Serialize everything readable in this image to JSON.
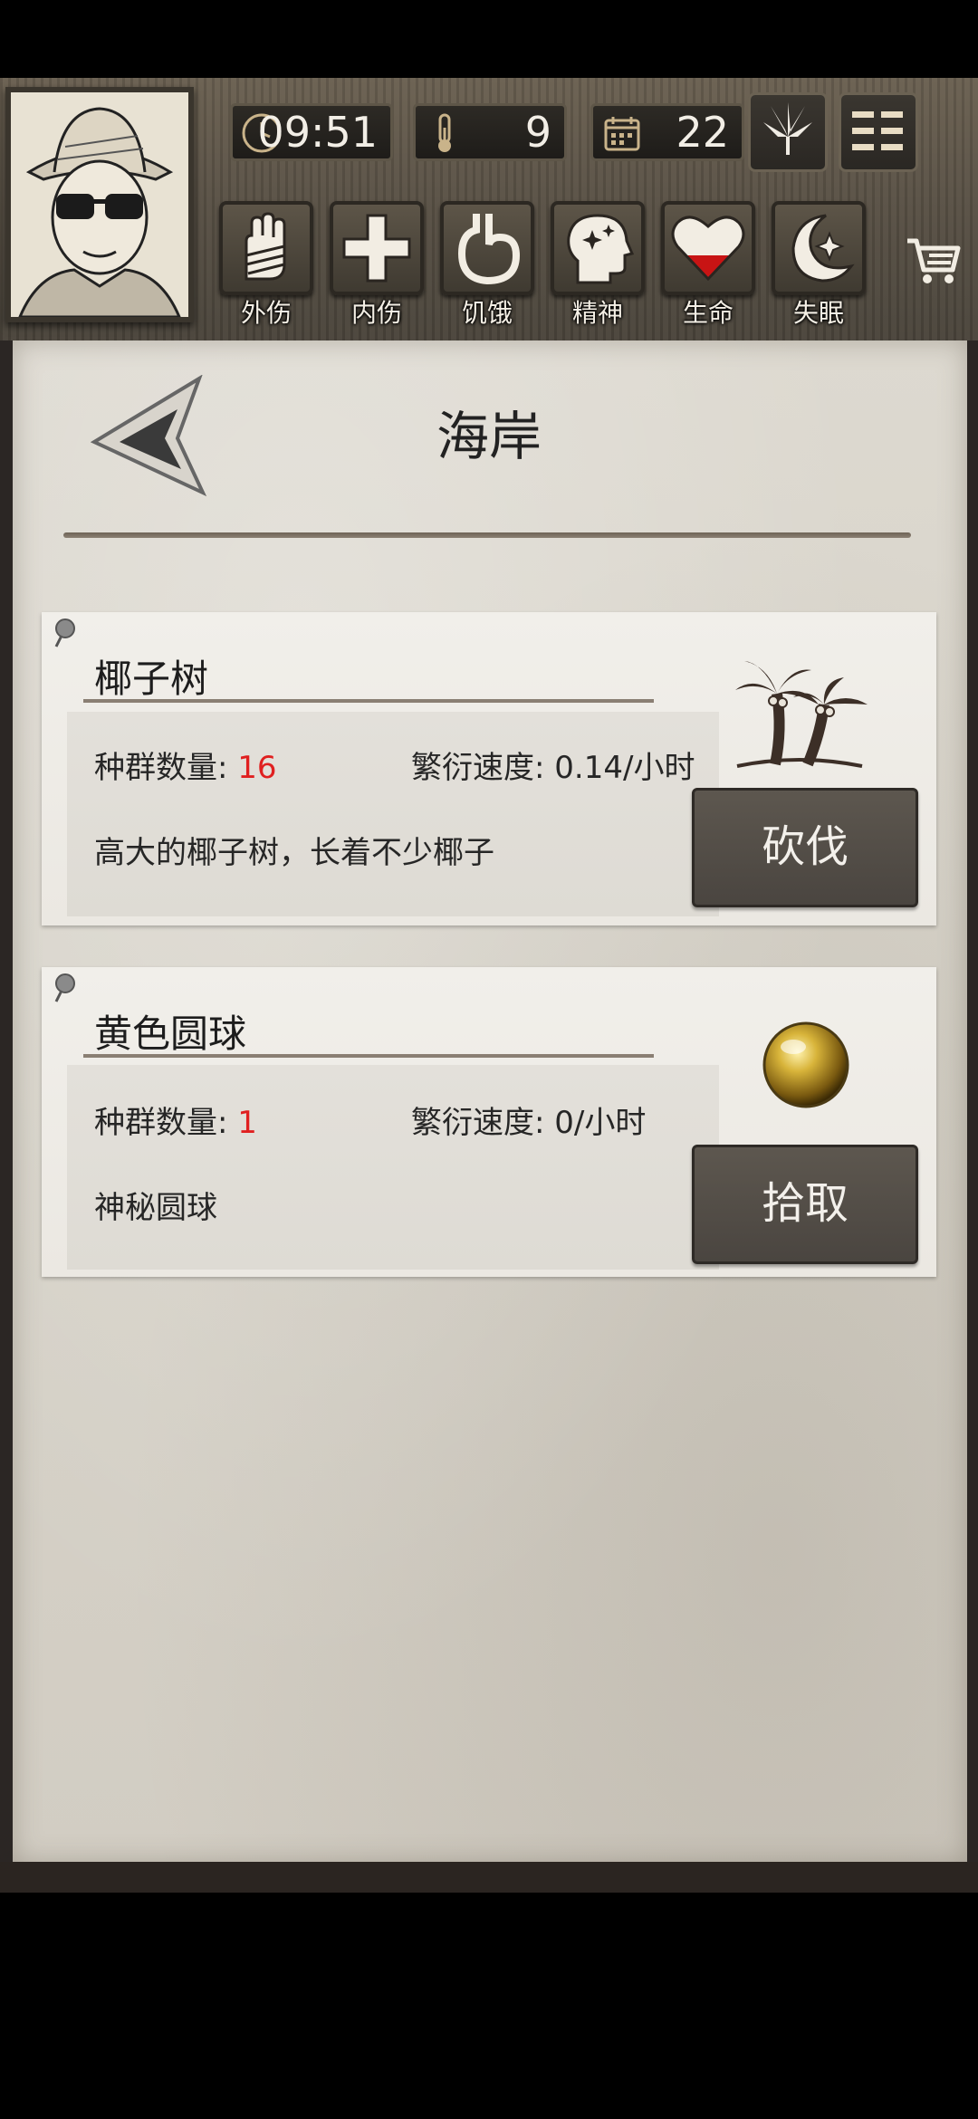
{
  "status_bar": {
    "time": "09:51",
    "temperature": "9",
    "day": "22"
  },
  "status_icons": [
    {
      "label": "外伤"
    },
    {
      "label": "内伤"
    },
    {
      "label": "饥饿"
    },
    {
      "label": "精神"
    },
    {
      "label": "生命",
      "level": 0.4
    },
    {
      "label": "失眠"
    }
  ],
  "colors": {
    "value_red": "#e02020",
    "health_fill": "#c81414"
  },
  "page": {
    "title": "海岸"
  },
  "items": [
    {
      "name": "椰子树",
      "count_label": "种群数量:",
      "count": "16",
      "rate_label": "繁衍速度:",
      "rate": "0.14/小时",
      "description": "高大的椰子树，长着不少椰子",
      "action": "砍伐",
      "icon": "palm-tree-icon"
    },
    {
      "name": "黄色圆球",
      "count_label": "种群数量:",
      "count": "1",
      "rate_label": "繁衍速度:",
      "rate": "0/小时",
      "description": "神秘圆球",
      "action": "拾取",
      "icon": "yellow-orb-icon"
    }
  ]
}
